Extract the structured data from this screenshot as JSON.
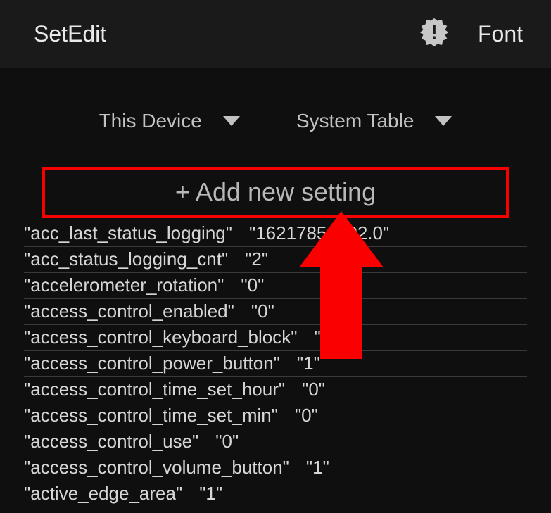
{
  "header": {
    "title": "SetEdit",
    "font_button": "Font"
  },
  "dropdowns": {
    "device": {
      "label": "This Device"
    },
    "table": {
      "label": "System Table"
    }
  },
  "add_button": {
    "label": "+ Add new setting"
  },
  "settings": [
    {
      "key": "acc_last_status_logging",
      "value": "16217856202.0"
    },
    {
      "key": "acc_status_logging_cnt",
      "value": "2"
    },
    {
      "key": "accelerometer_rotation",
      "value": "0"
    },
    {
      "key": "access_control_enabled",
      "value": "0"
    },
    {
      "key": "access_control_keyboard_block",
      "value": "0"
    },
    {
      "key": "access_control_power_button",
      "value": "1"
    },
    {
      "key": "access_control_time_set_hour",
      "value": "0"
    },
    {
      "key": "access_control_time_set_min",
      "value": "0"
    },
    {
      "key": "access_control_use",
      "value": "0"
    },
    {
      "key": "access_control_volume_button",
      "value": "1"
    },
    {
      "key": "active_edge_area",
      "value": "1"
    }
  ]
}
